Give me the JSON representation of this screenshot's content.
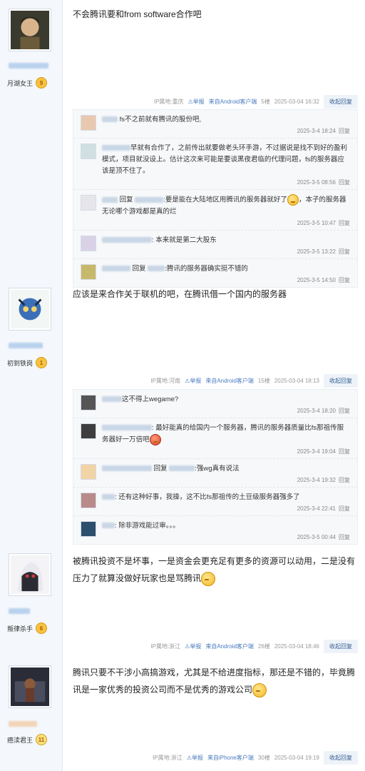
{
  "posts": [
    {
      "level_name": "月湖女王",
      "level": "9",
      "content": "不会腾讯要和from software合作吧",
      "ip": "IP属地:重庆",
      "report": "举报",
      "client": "来自Android客户端",
      "floor": "5楼",
      "time": "2025-03-04 16:32",
      "reply_label": "收起回复",
      "subs": [
        {
          "text": "fs不之前就有腾讯的股份吧,",
          "time": "2025-3-4 18:24",
          "reply": "回复"
        },
        {
          "text": "早就有合作了，之前传出就要做老头环手游，不过据说是找不到好的盈利模式，项目就没设上。估计这次来可能是要谈黑夜君临的代理问题，fs的服务器应该是顶不住了。",
          "time": "2025-3-5 08:56",
          "reply": "回复"
        },
        {
          "pre": "回复",
          "text": ":要是能在大陆地区用腾讯的服务器就好了",
          "text2": "，本子的服务器无论哪个游戏都是真的烂",
          "time": "2025-3-5 10:47",
          "reply": "回复"
        },
        {
          "text": ": 本来就是第二大股东",
          "time": "2025-3-5 13:22",
          "reply": "回复"
        },
        {
          "pre": "回复",
          "text": ":腾讯的服务器确实挺不错的",
          "time": "2025-3-5 14:50",
          "reply": "回复"
        }
      ]
    },
    {
      "level_name": "初到铁岗",
      "level": "1",
      "content": "应该是来合作关于联机的吧，在腾讯借一个国内的服务器",
      "ip": "IP属地:河南",
      "report": "举报",
      "client": "来自Android客户端",
      "floor": "15楼",
      "time": "2025-03-04 18:13",
      "reply_label": "收起回复",
      "subs": [
        {
          "text": "这不得上wegame?",
          "time": "2025-3-4 18:20",
          "reply": "回复"
        },
        {
          "text": ": 最好能真的给国内一个服务器，腾讯的服务器质量比fs那祖传服务器好一万倍吧",
          "time": "2025-3-4 19:04",
          "reply": "回复"
        },
        {
          "pre": "回复",
          "text": ":强wg真有说法",
          "time": "2025-3-4 19:32",
          "reply": "回复"
        },
        {
          "text": ": 还有这种好事，我操，这不比fs那祖传的土豆级服务器强多了",
          "time": "2025-3-4 22:41",
          "reply": "回复"
        },
        {
          "text": ": 除非游戏能过审。。。",
          "time": "2025-3-5 00:44",
          "reply": "回复"
        }
      ]
    },
    {
      "level_name": "叛律杀手",
      "level": "6",
      "content": "被腾讯投资不是坏事，一是资金会更充足有更多的资源可以动用，二是没有压力了就算没做好玩家也是骂腾讯",
      "ip": "IP属地:浙江",
      "report": "举报",
      "client": "来自Android客户端",
      "floor": "26楼",
      "time": "2025-03-04 18:46",
      "reply_label": "收起回复"
    },
    {
      "level_name": "癌渎君王",
      "level": "11",
      "content": "腾讯只要不干涉小高搞游戏，尤其是不给进度指标，那还是不错的，毕竟腾讯是一家优秀的投资公司而不是优秀的游戏公司",
      "ip": "IP属地:浙江",
      "report": "举报",
      "client": "来自iPhone客户端",
      "floor": "30楼",
      "time": "2025-03-04 19:19",
      "reply_label": "收起回复"
    }
  ],
  "colors": {
    "sidebar": "#f4f7fb",
    "link": "#4a7bbf",
    "reply_btn_bg": "#eef3f9"
  }
}
